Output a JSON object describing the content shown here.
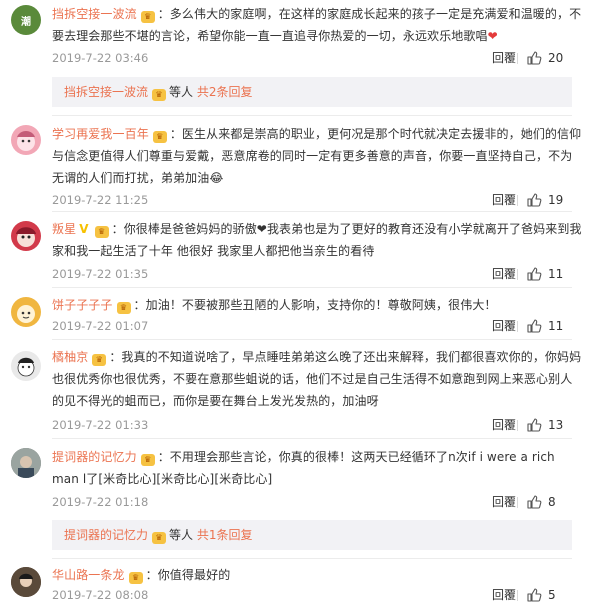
{
  "comments": [
    {
      "username": "挡拆空接一波流",
      "text": "：多么伟大的家庭啊，在这样的家庭成长起来的孩子一定是充满爱和温暖的，不要去理会那些不堪的言论，希望你能一直一直追寻你热爱的一切，永远欢乐地歌唱",
      "time": "2019-7-22 03:46",
      "reply_label": "回覆",
      "likes": "20",
      "avatar_text": "潮",
      "avatar_color": "#5a8a3a"
    },
    {
      "username": "学习再爱我一百年",
      "text": "：医生从来都是崇高的职业，更何况是那个时代就决定去援非的，她们的信仰与信念更值得人们尊重与爱戴，恶意席卷的同时一定有更多善意的声音，你要一直坚持自己，不为无谓的人们而打扰，弟弟加油",
      "time": "2019-7-22 11:25",
      "reply_label": "回覆",
      "likes": "19",
      "avatar_color": "#f2a7b6"
    },
    {
      "username": "叛星",
      "text": "：你很棒是爸爸妈妈的骄傲❤我表弟也是为了更好的教育还没有小学就离开了爸妈来到我家和我一起生活了十年 他很好 我家里人都把他当亲生的看待",
      "time": "2019-7-22 01:35",
      "reply_label": "回覆",
      "likes": "11",
      "avatar_color": "#d23a4a"
    },
    {
      "username": "饼子子子子",
      "text": "：加油！不要被那些丑陋的人影响，支持你的！尊敬阿姨，很伟大！",
      "time": "2019-7-22 01:07",
      "reply_label": "回覆",
      "likes": "11",
      "avatar_color": "#f0b640"
    },
    {
      "username": "橘柚京",
      "text": "：我真的不知道说啥了，早点睡哇弟弟这么晚了还出来解释，我们都很喜欢你的，你妈妈也很优秀你也很优秀，不要在意那些蛆说的话，他们不过是自己生活得不如意跑到网上来恶心别人的见不得光的蛆而已，而你是要在舞台上发光发热的，加油呀",
      "time": "2019-7-22 01:33",
      "reply_label": "回覆",
      "likes": "13",
      "avatar_color": "#e9e9e9"
    },
    {
      "username": "提词器的记忆力",
      "text": "：不用理会那些言论，你真的很棒！这两天已经循环了n次if i were a rich man l了[米奇比心][米奇比心][米奇比心]",
      "time": "2019-7-22 01:18",
      "reply_label": "回覆",
      "likes": "8",
      "avatar_color": "#7a7a7a"
    },
    {
      "username": "华山路一条龙",
      "text": "：你值得最好的",
      "time": "2019-7-22 08:08",
      "reply_label": "回覆",
      "likes": "5",
      "avatar_color": "#6a5a4a"
    }
  ],
  "subreplies": [
    {
      "username": "挡拆空接一波流",
      "middle": "等人",
      "link": "共2条回复"
    },
    {
      "username": "提词器的记忆力",
      "middle": "等人",
      "link": "共1条回复"
    }
  ]
}
